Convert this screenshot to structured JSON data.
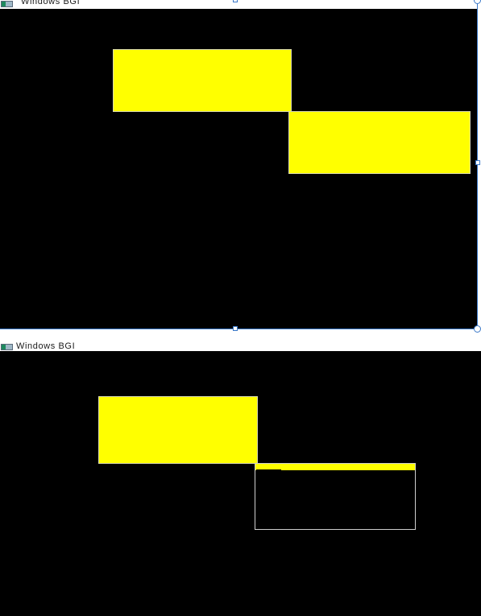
{
  "windows": [
    {
      "title": "Windows BGI",
      "icon": "bgi-app-icon",
      "canvas_color": "#000000",
      "rectangles": [
        {
          "fill": "#ffff00",
          "outline": "#d8d8b0"
        },
        {
          "fill": "#ffff00",
          "outline": "#d8d8b0"
        }
      ]
    },
    {
      "title": "Windows BGI",
      "icon": "bgi-app-icon",
      "canvas_color": "#000000",
      "rectangles": [
        {
          "fill": "#ffff00",
          "outline": "#d8d8b0"
        },
        {
          "fill": "#000000",
          "outline": "#cfcfcf",
          "top_band_fill": "#ffff00"
        }
      ]
    }
  ],
  "selection": {
    "handle_color": "#3a78c8"
  }
}
